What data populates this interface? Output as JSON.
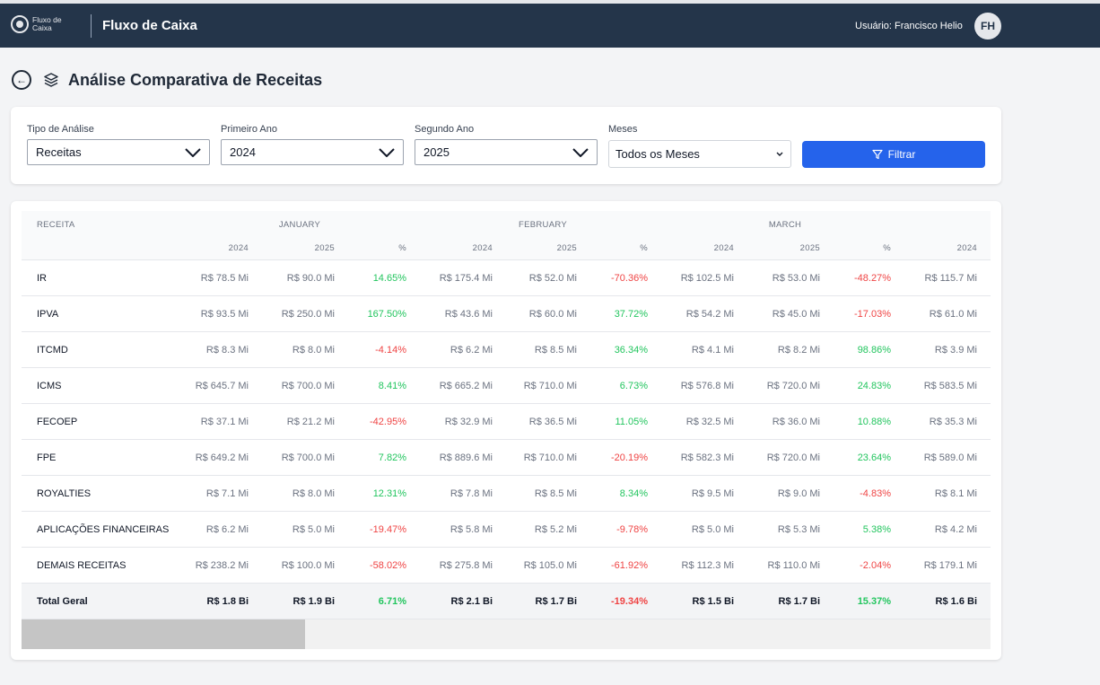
{
  "navbar": {
    "logo_text": "Fluxo de Caixa",
    "title": "Fluxo de Caixa",
    "user_label": "Usuário: Francisco Helio",
    "avatar_initials": "FH",
    "bg_color": "#24354a"
  },
  "page": {
    "title": "Análise Comparativa de Receitas",
    "back_icon": "arrow-left-circle-icon",
    "title_icon": "layers-icon"
  },
  "filters": {
    "tipo": {
      "label": "Tipo de Análise",
      "value": "Receitas"
    },
    "ano1": {
      "label": "Primeiro Ano",
      "value": "2024"
    },
    "ano2": {
      "label": "Segundo Ano",
      "value": "2025"
    },
    "meses": {
      "label": "Meses",
      "value": "Todos os Meses"
    },
    "button_label": "Filtrar",
    "button_icon": "funnel-icon",
    "button_color": "#2563eb"
  },
  "table": {
    "first_col_header": "RECEITA",
    "months": [
      "JANUARY",
      "FEBRUARY",
      "MARCH"
    ],
    "sub_headers": [
      "2024",
      "2025",
      "%",
      "2024",
      "2025",
      "%",
      "2024",
      "2025",
      "%",
      "2024"
    ],
    "rows": [
      {
        "name": "IR",
        "cells": [
          "R$ 78.5 Mi",
          "R$ 90.0 Mi",
          "14.65%",
          "R$ 175.4 Mi",
          "R$ 52.0 Mi",
          "-70.36%",
          "R$ 102.5 Mi",
          "R$ 53.0 Mi",
          "-48.27%",
          "R$ 115.7 Mi"
        ]
      },
      {
        "name": "IPVA",
        "cells": [
          "R$ 93.5 Mi",
          "R$ 250.0 Mi",
          "167.50%",
          "R$ 43.6 Mi",
          "R$ 60.0 Mi",
          "37.72%",
          "R$ 54.2 Mi",
          "R$ 45.0 Mi",
          "-17.03%",
          "R$ 61.0 Mi"
        ]
      },
      {
        "name": "ITCMD",
        "cells": [
          "R$ 8.3 Mi",
          "R$ 8.0 Mi",
          "-4.14%",
          "R$ 6.2 Mi",
          "R$ 8.5 Mi",
          "36.34%",
          "R$ 4.1 Mi",
          "R$ 8.2 Mi",
          "98.86%",
          "R$ 3.9 Mi"
        ]
      },
      {
        "name": "ICMS",
        "cells": [
          "R$ 645.7 Mi",
          "R$ 700.0 Mi",
          "8.41%",
          "R$ 665.2 Mi",
          "R$ 710.0 Mi",
          "6.73%",
          "R$ 576.8 Mi",
          "R$ 720.0 Mi",
          "24.83%",
          "R$ 583.5 Mi"
        ]
      },
      {
        "name": "FECOEP",
        "cells": [
          "R$ 37.1 Mi",
          "R$ 21.2 Mi",
          "-42.95%",
          "R$ 32.9 Mi",
          "R$ 36.5 Mi",
          "11.05%",
          "R$ 32.5 Mi",
          "R$ 36.0 Mi",
          "10.88%",
          "R$ 35.3 Mi"
        ]
      },
      {
        "name": "FPE",
        "cells": [
          "R$ 649.2 Mi",
          "R$ 700.0 Mi",
          "7.82%",
          "R$ 889.6 Mi",
          "R$ 710.0 Mi",
          "-20.19%",
          "R$ 582.3 Mi",
          "R$ 720.0 Mi",
          "23.64%",
          "R$ 589.0 Mi"
        ]
      },
      {
        "name": "ROYALTIES",
        "cells": [
          "R$ 7.1 Mi",
          "R$ 8.0 Mi",
          "12.31%",
          "R$ 7.8 Mi",
          "R$ 8.5 Mi",
          "8.34%",
          "R$ 9.5 Mi",
          "R$ 9.0 Mi",
          "-4.83%",
          "R$ 8.1 Mi"
        ]
      },
      {
        "name": "APLICAÇÕES FINANCEIRAS",
        "cells": [
          "R$ 6.2 Mi",
          "R$ 5.0 Mi",
          "-19.47%",
          "R$ 5.8 Mi",
          "R$ 5.2 Mi",
          "-9.78%",
          "R$ 5.0 Mi",
          "R$ 5.3 Mi",
          "5.38%",
          "R$ 4.2 Mi"
        ]
      },
      {
        "name": "DEMAIS RECEITAS",
        "cells": [
          "R$ 238.2 Mi",
          "R$ 100.0 Mi",
          "-58.02%",
          "R$ 275.8 Mi",
          "R$ 105.0 Mi",
          "-61.92%",
          "R$ 112.3 Mi",
          "R$ 110.0 Mi",
          "-2.04%",
          "R$ 179.1 Mi"
        ]
      }
    ],
    "total": {
      "name": "Total Geral",
      "cells": [
        "R$ 1.8 Bi",
        "R$ 1.9 Bi",
        "6.71%",
        "R$ 2.1 Bi",
        "R$ 1.7 Bi",
        "-19.34%",
        "R$ 1.5 Bi",
        "R$ 1.7 Bi",
        "15.37%",
        "R$ 1.6 Bi"
      ]
    },
    "positive_color": "#22c55e",
    "negative_color": "#ef4444"
  }
}
